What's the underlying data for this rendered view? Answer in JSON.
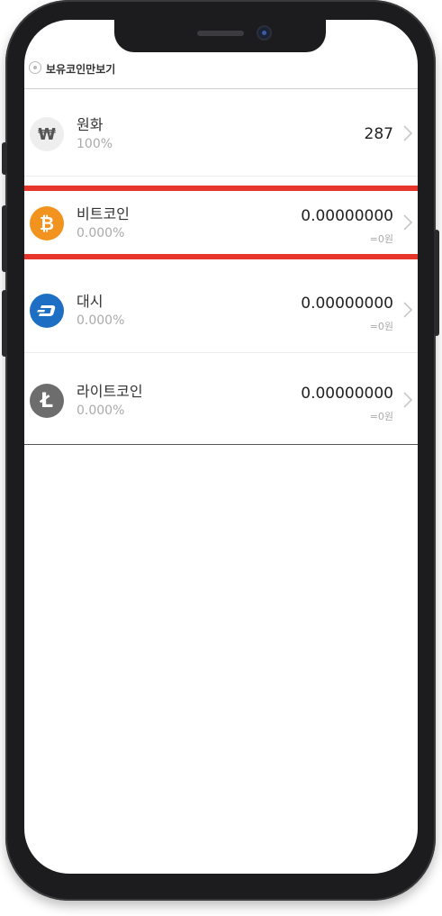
{
  "header": {
    "label": "보유코인만보기"
  },
  "assets": [
    {
      "name": "원화",
      "percent": "100%",
      "amount": "287",
      "krw_value": "",
      "icon": "won-icon",
      "icon_glyph": "₩",
      "color": "#eeeeee",
      "glyph_color": "#555555"
    },
    {
      "name": "비트코인",
      "percent": "0.000%",
      "amount": "0.00000000",
      "krw_value": "=0원",
      "icon": "bitcoin-icon",
      "icon_glyph": "₿",
      "color": "#f2921f",
      "glyph_color": "#ffffff"
    },
    {
      "name": "대시",
      "percent": "0.000%",
      "amount": "0.00000000",
      "krw_value": "=0원",
      "icon": "dash-icon",
      "icon_glyph": "D",
      "color": "#1e6fc4",
      "glyph_color": "#ffffff"
    },
    {
      "name": "라이트코인",
      "percent": "0.000%",
      "amount": "0.00000000",
      "krw_value": "=0원",
      "icon": "litecoin-icon",
      "icon_glyph": "Ł",
      "color": "#6d6d6d",
      "glyph_color": "#ffffff"
    }
  ],
  "colors": {
    "highlight": "#e8352b"
  }
}
